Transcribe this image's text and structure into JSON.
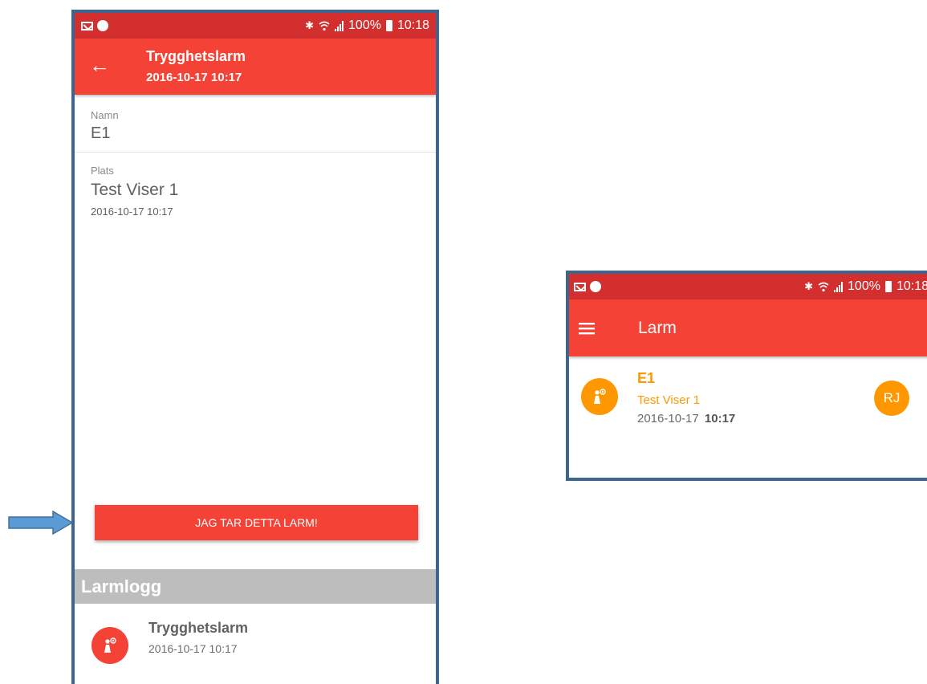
{
  "left_screen": {
    "status_bar": {
      "battery": "100%",
      "time": "10:18"
    },
    "app_bar": {
      "title": "Trygghetslarm",
      "subtitle": "2016-10-17 10:17"
    },
    "fields": {
      "name_label": "Namn",
      "name_value": "E1",
      "place_label": "Plats",
      "place_value": "Test Viser 1",
      "place_time": "2016-10-17 10:17"
    },
    "take_alarm_button": "JAG TAR DETTA LARM!",
    "log": {
      "header": "Larmlogg",
      "entry_title": "Trygghetslarm",
      "entry_time": "2016-10-17 10:17"
    }
  },
  "right_screen": {
    "status_bar": {
      "battery": "100%",
      "time": "10:18"
    },
    "app_bar": {
      "title": "Larm"
    },
    "alarm_item": {
      "name": "E1",
      "place": "Test Viser 1",
      "date": "2016-10-17",
      "time": "10:17",
      "assignee_initials": "RJ"
    }
  },
  "colors": {
    "status_bar": "#d32f2f",
    "app_bar": "#f44336",
    "accent_orange": "#ff9800",
    "frame_border": "#3d6591",
    "annotation_arrow": "#5b9bd5"
  },
  "icons": [
    "mail-icon",
    "sync-icon",
    "bluetooth-icon",
    "wifi-icon",
    "signal-icon",
    "battery-icon",
    "back-arrow-icon",
    "menu-icon",
    "person-alarm-icon"
  ]
}
